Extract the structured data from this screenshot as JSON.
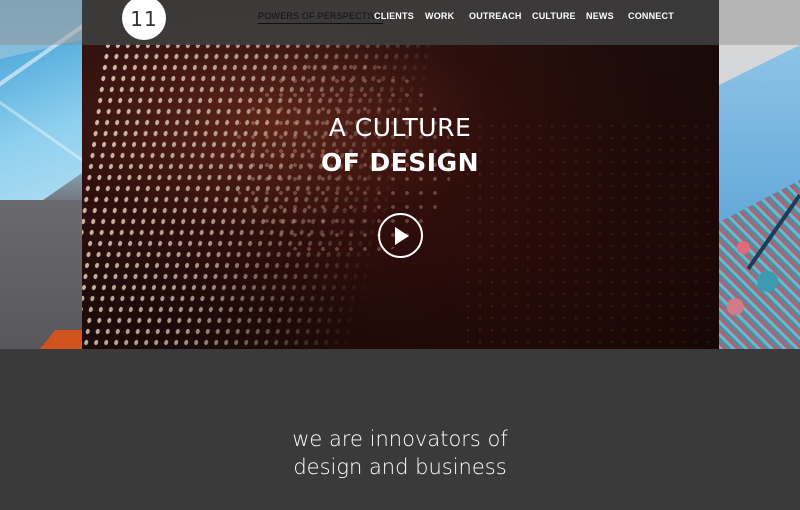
{
  "brand": {
    "logo_text": "11"
  },
  "nav": {
    "items": [
      {
        "label": "POWERS OF PERSPECTIVE",
        "active": true
      },
      {
        "label": "CLIENTS"
      },
      {
        "label": "WORK"
      },
      {
        "label": "OUTREACH"
      },
      {
        "label": "CULTURE"
      },
      {
        "label": "NEWS"
      },
      {
        "label": "CONNECT"
      }
    ]
  },
  "hero": {
    "headline_line1": "A CULTURE",
    "headline_line2": "OF DESIGN",
    "play_icon": "play-icon"
  },
  "intro": {
    "tagline_line1": "we are innovators of",
    "tagline_line2": "design and business"
  },
  "colors": {
    "page_background": "#3a3a3a",
    "nav_bar": "#373737",
    "text": "#ffffff",
    "accent_orange": "#d2531e"
  }
}
